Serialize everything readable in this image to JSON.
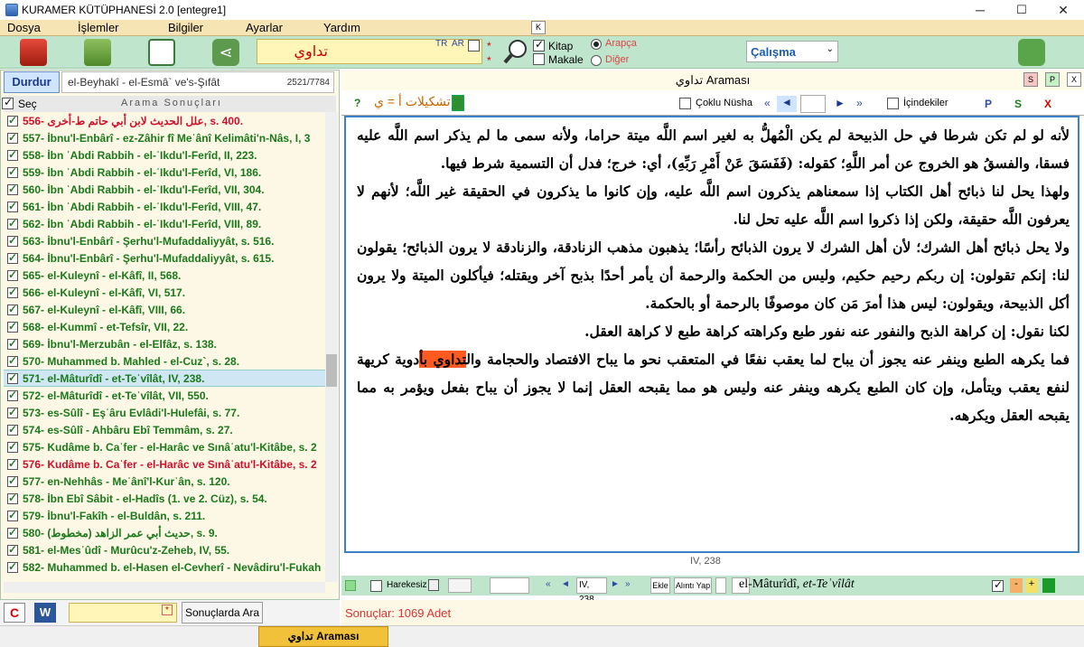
{
  "window": {
    "title": "KURAMER KÜTÜPHANESİ 2.0 [entegre1]",
    "min": "─",
    "max": "☐",
    "close": "✕"
  },
  "menu": [
    "Dosya",
    "İşlemler",
    "Bilgiler",
    "Ayarlar",
    "Yardım"
  ],
  "menu_k": "K",
  "toolbar": {
    "search_value": "تداوي",
    "lang_tr": "TR",
    "lang_ar": "AR",
    "star_top": "*",
    "star_bottom": "*",
    "kitap_label": "Kitap",
    "makale_label": "Makale",
    "arapca_label": "Arapça",
    "diger_label": "Diğer",
    "mode_select": "Çalışma"
  },
  "left": {
    "stop_button": "Durdur",
    "book_field": "el-Beyhakî - el-Esmâ` ve's-Şıfât",
    "count": "2521/7784",
    "select_label": "Seç",
    "results_header": "Arama Sonuçları",
    "results": [
      {
        "text": "556- علل الحديث لابن أبي حاتم ط-أخرى, s. 400.",
        "color": "#d0102a"
      },
      {
        "text": "557- İbnu'l-Enbârî - ez-Zâhir fî Meʿânî Kelimâti'n-Nâs, I, 3",
        "color": "#1a7a1a"
      },
      {
        "text": "558- İbn ʿAbdi Rabbih - el-ʿIkdu'l-Ferîd, II, 223.",
        "color": "#1a7a1a"
      },
      {
        "text": "559- İbn ʿAbdi Rabbih - el-ʿIkdu'l-Ferîd, VI, 186.",
        "color": "#1a7a1a"
      },
      {
        "text": "560- İbn ʿAbdi Rabbih - el-ʿIkdu'l-Ferîd, VII, 304.",
        "color": "#1a7a1a"
      },
      {
        "text": "561- İbn ʿAbdi Rabbih - el-ʿIkdu'l-Ferîd, VIII, 47.",
        "color": "#1a7a1a"
      },
      {
        "text": "562- İbn ʿAbdi Rabbih - el-ʿIkdu'l-Ferîd, VIII, 89.",
        "color": "#1a7a1a"
      },
      {
        "text": "563- İbnu'l-Enbârî - Şerhu'l-Mufaddaliyyât, s. 516.",
        "color": "#1a7a1a"
      },
      {
        "text": "564- İbnu'l-Enbârî - Şerhu'l-Mufaddaliyyât, s. 615.",
        "color": "#1a7a1a"
      },
      {
        "text": "565- el-Kuleynî - el-Kâfî, II, 568.",
        "color": "#1a7a1a"
      },
      {
        "text": "566- el-Kuleynî - el-Kâfî, VI, 517.",
        "color": "#1a7a1a"
      },
      {
        "text": "567- el-Kuleynî - el-Kâfî, VIII, 66.",
        "color": "#1a7a1a"
      },
      {
        "text": "568- el-Kummî - et-Tefsîr, VII, 22.",
        "color": "#1a7a1a"
      },
      {
        "text": "569- İbnu'l-Merzubân - el-Elfâz, s. 138.",
        "color": "#1a7a1a"
      },
      {
        "text": "570- Muhammed b. Mahled - el-Cuz`, s. 28.",
        "color": "#1a7a1a"
      },
      {
        "text": "571- el-Mâturîdî - et-Teʾvîlât, IV, 238.",
        "color": "#1a7a1a"
      },
      {
        "text": "572- el-Mâturîdî - et-Teʾvîlât, VII, 550.",
        "color": "#1a7a1a"
      },
      {
        "text": "573- es-Sûlî - Eşʿâru Evlâdi'l-Hulefâi, s. 77.",
        "color": "#1a7a1a"
      },
      {
        "text": "574- es-Sûlî - Ahbâru Ebî Temmâm, s. 27.",
        "color": "#1a7a1a"
      },
      {
        "text": "575- Kudâme b. Caʿfer - el-Harâc ve Sınâʿatu'l-Kitâbe, s. 2",
        "color": "#1a7a1a"
      },
      {
        "text": "576- Kudâme b. Caʿfer - el-Harâc ve Sınâʿatu'l-Kitâbe, s. 2",
        "color": "#d0102a"
      },
      {
        "text": "577- en-Nehhâs - Meʿânî'l-Kurʾân, s. 120.",
        "color": "#1a7a1a"
      },
      {
        "text": "578- İbn Ebî Sâbit - el-Hadîs (1. ve 2. Cüz), s. 54.",
        "color": "#1a7a1a"
      },
      {
        "text": "579- İbnu'l-Fakîh - el-Buldân, s. 211.",
        "color": "#1a7a1a"
      },
      {
        "text": "580- (حديث أبي عمر الزاهد (مخطوط, s. 9.",
        "color": "#1a7a1a"
      },
      {
        "text": "581- el-Mesʿûdî - Murûcu'z-Zeheb, IV, 55.",
        "color": "#1a7a1a"
      },
      {
        "text": "582- Muhammed b. el-Hasen el-Cevherî - Nevâdiru'l-Fukah",
        "color": "#1a7a1a"
      }
    ],
    "c_button": "C",
    "word_icon": "W",
    "results_search_star": "*",
    "search_in_results": "Sonuçlarda Ara"
  },
  "right": {
    "header": "تداوي Araması",
    "btn_s": "S",
    "btn_p": "P",
    "btn_x": "X",
    "help": "?",
    "tashkilat": "تشكيلات أ = ي",
    "coklu_nusha": "Çoklu Nüsha",
    "nav_first": "«",
    "nav_prev": "◄",
    "nav_next": "►",
    "nav_last": "»",
    "icindekiler": "İçindekiler",
    "p": "P",
    "s": "S",
    "x": "X",
    "paragraphs": [
      {
        "pre": "لأنه لو لم تكن شرطا في حل الذبيحة لم يكن الْمُهلُّ به لغير اسم اللَّه ميتة حراما، ولأنه سمى ما لم يذكر اسم اللَّه عليه فسقا، والفسقُ هو الخروج عن أمر اللَّهِ؛ كقوله: (فَفَسَقَ عَنْ أَمْرِ رَبِّهِ)، أي: خرج؛ فدل أن التسمية شرط فيها.",
        "hl": "",
        "post": ""
      },
      {
        "pre": "ولهذا يحل لنا ذبائح أهل الكتاب إذا سمعناهم يذكرون اسم اللَّه عليه، وإن كانوا ما يذكرون في الحقيقة غير اللَّه؛ لأنهم لا يعرفون اللَّه حقيقة، ولكن إذا ذكروا اسم اللَّه عليه تحل لنا.",
        "hl": "",
        "post": ""
      },
      {
        "pre": "ولا يحل ذبائح أهل الشرك؛ لأن أهل الشرك لا يرون الذبائح رأسًا؛ يذهبون مذهب الزنادقة، والزنادقة لا يرون الذبائح؛ يقولون لنا: إنكم تقولون: إن ربكم رحيم حكيم، وليس من الحكمة والرحمة أن يأمر أحدًا بذبح آخر ويقتله؛ فيأكلون الميتة ولا يرون أكل الذبيحة، ويقولون: ليس هذا أمرَ مَن كان موصوفًا بالرحمة أو بالحكمة.",
        "hl": "",
        "post": ""
      },
      {
        "pre": "لكنا نقول: إن كراهة الذبح والنفور عنه نفور طبع وكراهته كراهة طبع لا كراهة العقل.",
        "hl": "",
        "post": ""
      },
      {
        "pre": "فما يكرهه الطبع وينفر عنه يجوز أن يباح لما يعقب نفعًا في المتعقب نحو ما يباح الافتصاد والحجامة وال",
        "hl": "تداوي بأ",
        "post": "دوية كريهة لنفع يعقب ويتأمل، وإن كان الطبع يكرهه وينفر عنه وليس هو مما يقبحه العقل إنما لا يجوز أن يباح بفعل ويؤمر به مما يقبحه العقل ويكرهه."
      }
    ],
    "page_info": "IV, 238",
    "harekesiz": "Harekesiz",
    "page_field": "IV, 238",
    "ekle": "Ekle",
    "alinti": "Alıntı Yap",
    "book_name_a": "el-Mâturîdî, ",
    "book_name_b": "et-Teʾvîlât",
    "minus": "-",
    "plus": "+",
    "results_count": "Sonuçlar: 1069 Adet"
  },
  "taskbar": {
    "tab": "تداوي Araması"
  }
}
